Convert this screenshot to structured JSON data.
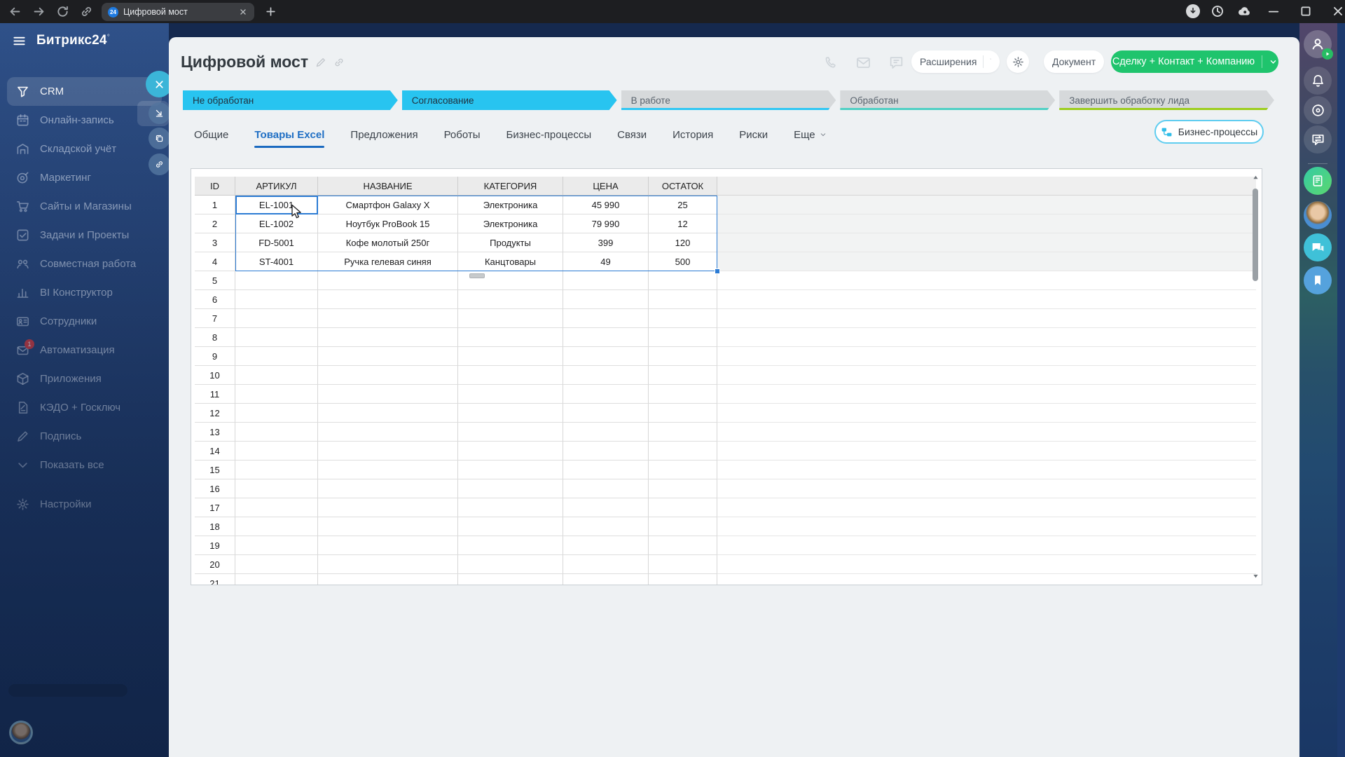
{
  "browser": {
    "tab": {
      "title": "Цифровой мост",
      "favicon": "24"
    }
  },
  "sidebar": {
    "logo": "Битрикс24",
    "logo_mark": "°",
    "items": [
      {
        "name": "crm",
        "label": "CRM",
        "icon": "funnel-icon",
        "active": true
      },
      {
        "name": "online-booking",
        "label": "Онлайн-запись",
        "icon": "calendar-icon"
      },
      {
        "name": "inventory",
        "label": "Складской учёт",
        "icon": "warehouse-icon"
      },
      {
        "name": "marketing",
        "label": "Маркетинг",
        "icon": "target-icon"
      },
      {
        "name": "sites-stores",
        "label": "Сайты и Магазины",
        "icon": "cart-icon"
      },
      {
        "name": "tasks-projects",
        "label": "Задачи и Проекты",
        "icon": "check-square-icon"
      },
      {
        "name": "collaboration",
        "label": "Совместная работа",
        "icon": "people-icon"
      },
      {
        "name": "bi-builder",
        "label": "BI Конструктор",
        "icon": "bar-chart-icon"
      },
      {
        "name": "employees",
        "label": "Сотрудники",
        "icon": "id-card-icon"
      },
      {
        "name": "automation",
        "label": "Автоматизация",
        "icon": "envelope-icon",
        "badge": "1"
      },
      {
        "name": "apps",
        "label": "Приложения",
        "icon": "cube-icon"
      },
      {
        "name": "kedo-goskluch",
        "label": "КЭДО + Госключ",
        "icon": "doc-sign-icon"
      },
      {
        "name": "sign",
        "label": "Подпись",
        "icon": "pen-icon"
      },
      {
        "name": "show-all",
        "label": "Показать все",
        "icon": "chevron-down-icon"
      },
      {
        "name": "settings",
        "label": "Настройки",
        "icon": "gear-icon",
        "settings": true
      }
    ]
  },
  "lead": {
    "title": "Цифровой мост",
    "stages": [
      {
        "label": "Не обработан",
        "state": "done"
      },
      {
        "label": "Согласование",
        "state": "current"
      },
      {
        "label": "В работе",
        "state": "pending",
        "underline": "#2fc7f4"
      },
      {
        "label": "Обработан",
        "state": "pending",
        "underline": "#4fd0c4"
      },
      {
        "label": "Завершить обработку лида",
        "state": "pending",
        "underline": "#9ccd1c"
      }
    ],
    "actions": {
      "extensions": "Расширения",
      "document": "Документ",
      "create": "Сделку + Контакт + Компанию"
    },
    "tabs": [
      {
        "label": "Общие"
      },
      {
        "label": "Товары Excel",
        "active": true
      },
      {
        "label": "Предложения"
      },
      {
        "label": "Роботы"
      },
      {
        "label": "Бизнес-процессы"
      },
      {
        "label": "Связи"
      },
      {
        "label": "История"
      },
      {
        "label": "Риски"
      },
      {
        "label": "Еще",
        "chevron": true
      }
    ],
    "bp_button": "Бизнес-процессы"
  },
  "spreadsheet": {
    "columns": [
      "ID",
      "АРТИКУЛ",
      "НАЗВАНИЕ",
      "КАТЕГОРИЯ",
      "ЦЕНА",
      "ОСТАТОК"
    ],
    "rows": [
      [
        "1",
        "EL-1001",
        "Смартфон Galaxy X",
        "Электроника",
        "45 990",
        "25"
      ],
      [
        "2",
        "EL-1002",
        "Ноутбук ProBook 15",
        "Электроника",
        "79 990",
        "12"
      ],
      [
        "3",
        "FD-5001",
        "Кофе молотый 250г",
        "Продукты",
        "399",
        "120"
      ],
      [
        "4",
        "ST-4001",
        "Ручка гелевая синяя",
        "Канцтовары",
        "49",
        "500"
      ]
    ],
    "visible_row_count": 21,
    "selection": {
      "range_rows": "1-4",
      "range_columns": "АРТИКУЛ–ОСТАТОК",
      "active_cell": "EL-1001"
    }
  }
}
